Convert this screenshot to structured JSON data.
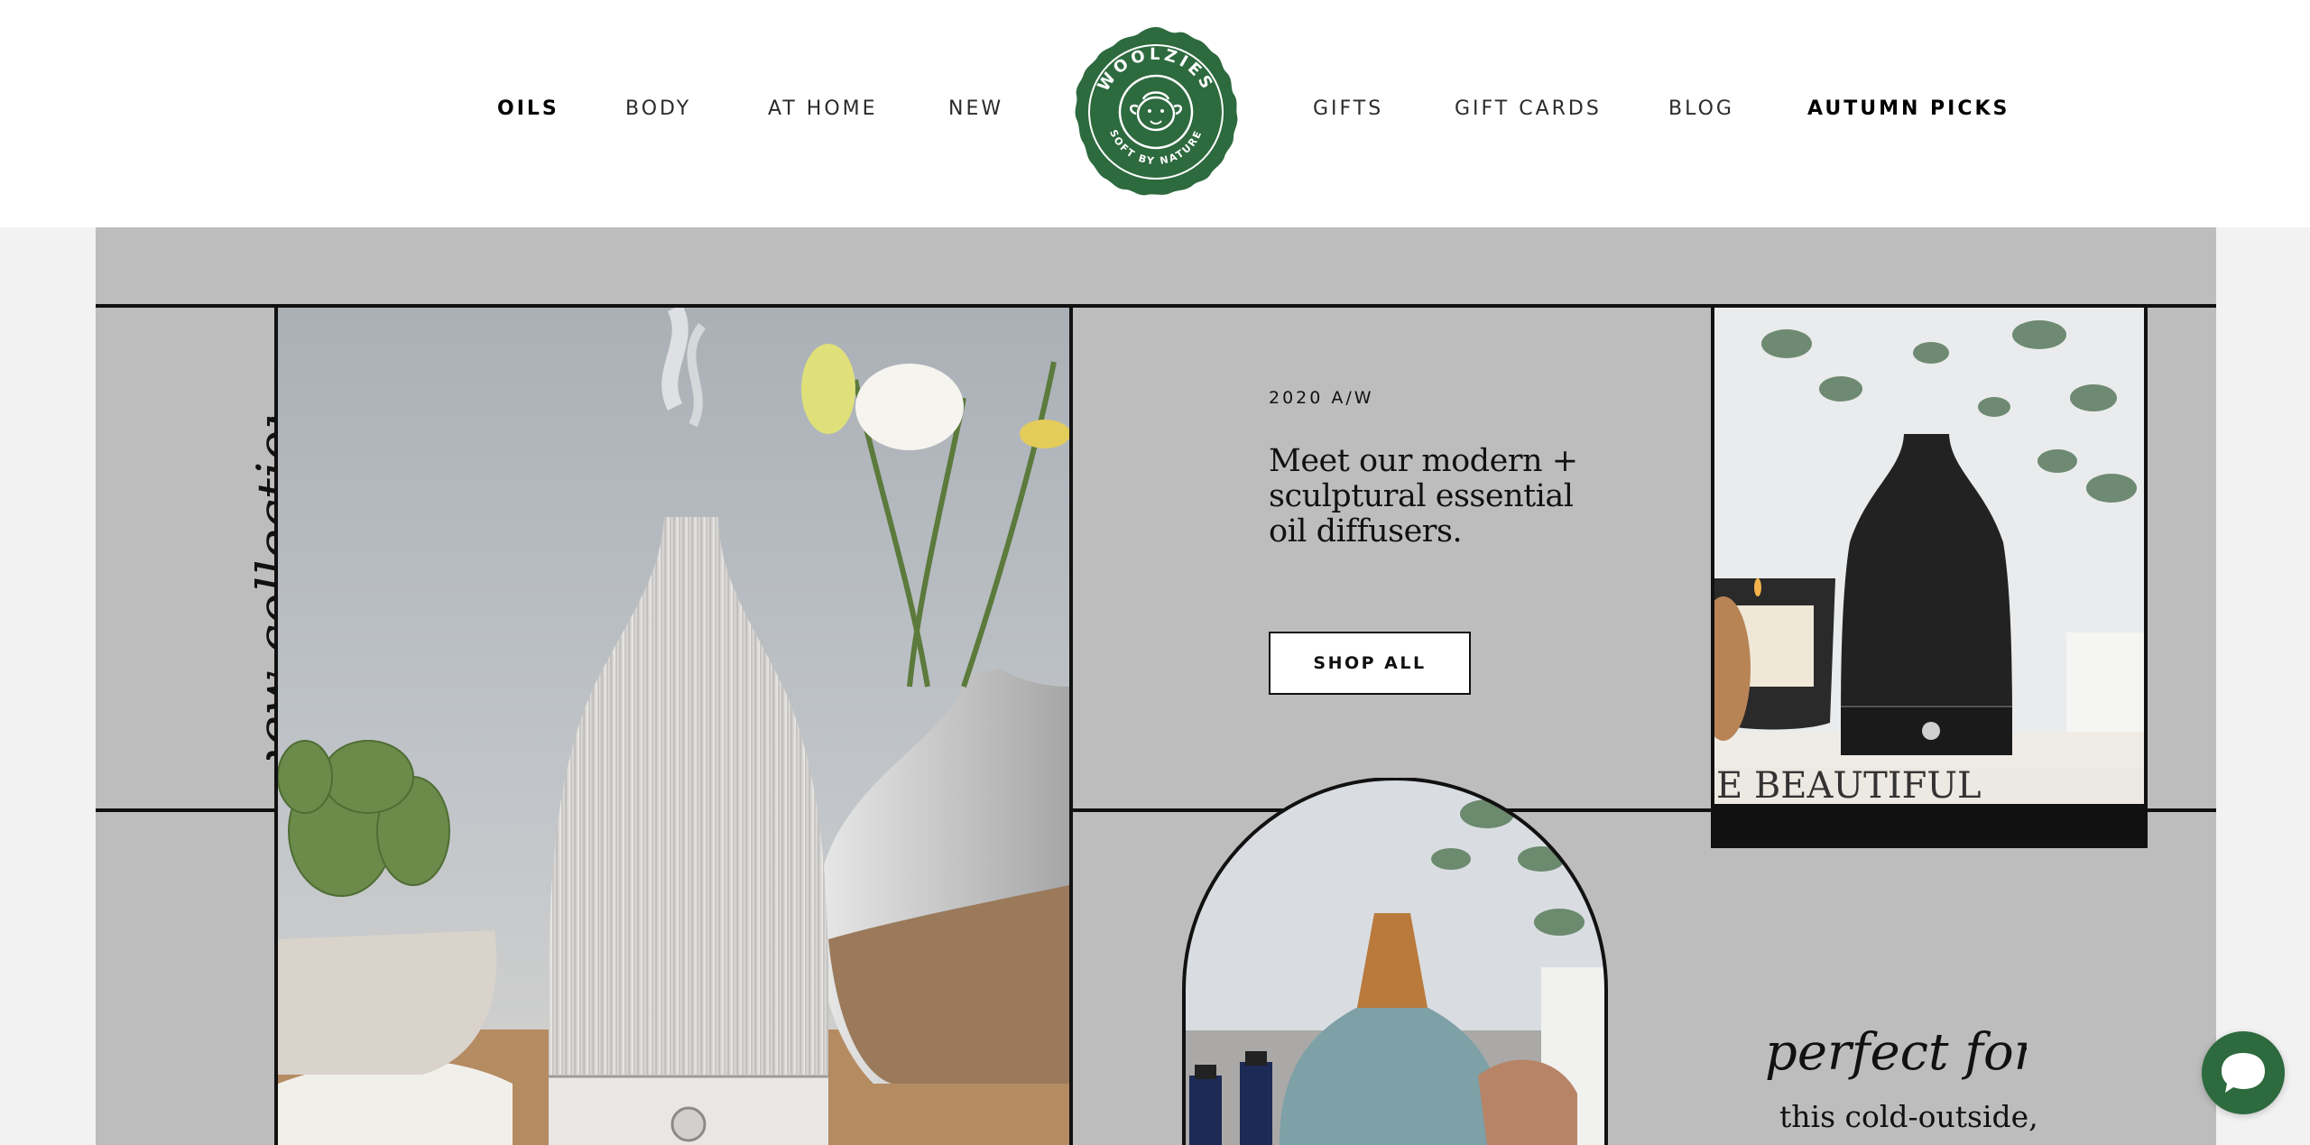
{
  "nav": {
    "left": [
      {
        "label": "OILS"
      },
      {
        "label": "BODY"
      },
      {
        "label": "AT HOME"
      },
      {
        "label": "NEW"
      }
    ],
    "right": [
      {
        "label": "GIFTS"
      },
      {
        "label": "GIFT CARDS"
      },
      {
        "label": "BLOG"
      },
      {
        "label": "AUTUMN PICKS"
      }
    ]
  },
  "logo": {
    "brand": "WOOLZIES",
    "tagline": "SOFT BY NATURE",
    "color": "#2d6a3e"
  },
  "hero": {
    "script_left": "new collection",
    "eyebrow": "2020 A/W",
    "headline": "Meet our modern + sculptural essential oil diffusers.",
    "cta_label": "SHOP ALL",
    "book_title": "E BEAUTIFUL",
    "script_perfect": "perfect for",
    "cold_text": "this cold-outside,"
  },
  "chat": {
    "icon": "chat-bubble-icon",
    "color": "#2d6a3e"
  }
}
